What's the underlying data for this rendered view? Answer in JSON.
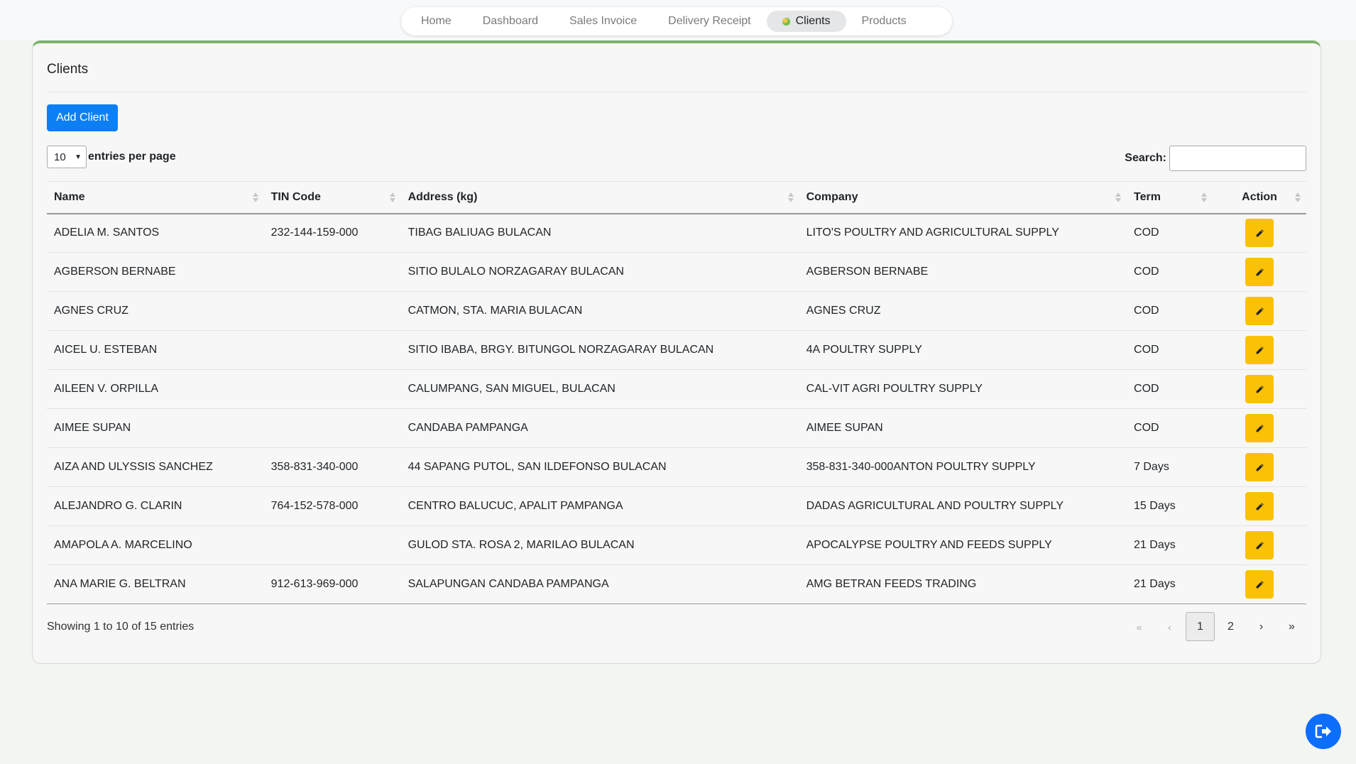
{
  "nav": {
    "items": [
      {
        "label": "Home",
        "active": false
      },
      {
        "label": "Dashboard",
        "active": false
      },
      {
        "label": "Sales Invoice",
        "active": false
      },
      {
        "label": "Delivery Receipt",
        "active": false
      },
      {
        "label": "Clients",
        "active": true
      },
      {
        "label": "Products",
        "active": false
      }
    ]
  },
  "page": {
    "title": "Clients",
    "add_button_label": "Add Client"
  },
  "table_controls": {
    "entries_value": "10",
    "entries_label": "entries per page",
    "search_label": "Search:",
    "search_value": ""
  },
  "table": {
    "columns": [
      "Name",
      "TIN Code",
      "Address (kg)",
      "Company",
      "Term",
      "Action"
    ],
    "rows": [
      [
        "ADELIA M. SANTOS",
        "232-144-159-000",
        "TIBAG BALIUAG BULACAN",
        "LITO'S POULTRY AND AGRICULTURAL SUPPLY",
        "COD"
      ],
      [
        "AGBERSON BERNABE",
        "",
        "SITIO BULALO NORZAGARAY BULACAN",
        "AGBERSON BERNABE",
        "COD"
      ],
      [
        "AGNES CRUZ",
        "",
        "CATMON, STA. MARIA BULACAN",
        "AGNES CRUZ",
        "COD"
      ],
      [
        "AICEL U. ESTEBAN",
        "",
        "SITIO IBABA, BRGY. BITUNGOL NORZAGARAY BULACAN",
        "4A POULTRY SUPPLY",
        "COD"
      ],
      [
        "AILEEN V. ORPILLA",
        "",
        "CALUMPANG, SAN MIGUEL, BULACAN",
        "CAL-VIT AGRI POULTRY SUPPLY",
        "COD"
      ],
      [
        "AIMEE SUPAN",
        "",
        "CANDABA PAMPANGA",
        "AIMEE SUPAN",
        "COD"
      ],
      [
        "AIZA AND ULYSSIS SANCHEZ",
        "358-831-340-000",
        "44 SAPANG PUTOL, SAN ILDEFONSO BULACAN",
        "358-831-340-000ANTON POULTRY SUPPLY",
        "7 Days"
      ],
      [
        "ALEJANDRO G. CLARIN",
        "764-152-578-000",
        "CENTRO BALUCUC, APALIT PAMPANGA",
        "DADAS AGRICULTURAL AND POULTRY SUPPLY",
        "15 Days"
      ],
      [
        "AMAPOLA A. MARCELINO",
        "",
        "GULOD STA. ROSA 2, MARILAO BULACAN",
        "APOCALYPSE POULTRY AND FEEDS SUPPLY",
        "21 Days"
      ],
      [
        "ANA MARIE G. BELTRAN",
        "912-613-969-000",
        "SALAPUNGAN CANDABA PAMPANGA",
        "AMG BETRAN FEEDS TRADING",
        "21 Days"
      ]
    ],
    "action_icon": "pencil-icon"
  },
  "footer": {
    "info": "Showing 1 to 10 of 15 entries",
    "pages": [
      "«",
      "‹",
      "1",
      "2",
      "›",
      "»"
    ],
    "current_page": "1"
  },
  "colors": {
    "primary": "#0d7ff5",
    "edit": "#fbc107",
    "card_accent": "#7db36c",
    "logout": "#0d6efd"
  },
  "icons": {
    "logout": "logout-icon",
    "nav_active": "status-dot-icon"
  }
}
